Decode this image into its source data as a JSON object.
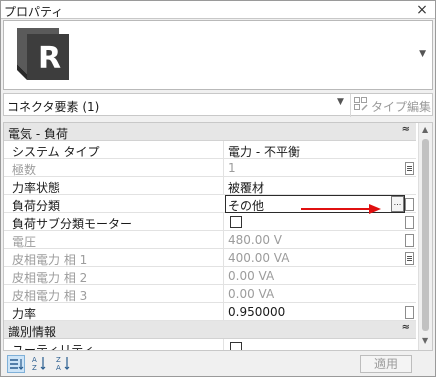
{
  "window": {
    "title": "プロパティ",
    "close_glyph": "×"
  },
  "preview": {
    "logo_letter": "R",
    "dropdown_glyph": "▼"
  },
  "type_selector": {
    "label": "コネクタ要素 (1)",
    "dropdown_glyph": "▼",
    "edit_type_label": "タイプ編集"
  },
  "groups": {
    "electrical_load": {
      "label": "電気 - 負荷",
      "toggle": "≈"
    },
    "identity": {
      "label": "識別情報",
      "toggle": "≈"
    }
  },
  "rows": [
    {
      "name": "システム タイプ",
      "value": "電力 - 不平衡"
    },
    {
      "name": "極数",
      "value": "1"
    },
    {
      "name": "力率状態",
      "value": "被覆材"
    },
    {
      "name": "負荷分類",
      "value": "その他"
    },
    {
      "name": "負荷サブ分類モーター",
      "value": ""
    },
    {
      "name": "電圧",
      "value": "480.00 V"
    },
    {
      "name": "皮相電力 相 1",
      "value": "400.00 VA"
    },
    {
      "name": "皮相電力 相 2",
      "value": "0.00 VA"
    },
    {
      "name": "皮相電力 相 3",
      "value": "0.00 VA"
    },
    {
      "name": "力率",
      "value": "0.950000"
    }
  ],
  "identity_rows": [
    {
      "name": "ユーティリティ",
      "value": ""
    }
  ],
  "ellipsis_label": "...",
  "bottom": {
    "apply_label": "適用"
  },
  "colors": {
    "annotation_arrow": "#e01010",
    "sort_active_bg": "#cde4f7",
    "logo_dark": "#3d3d3d"
  }
}
